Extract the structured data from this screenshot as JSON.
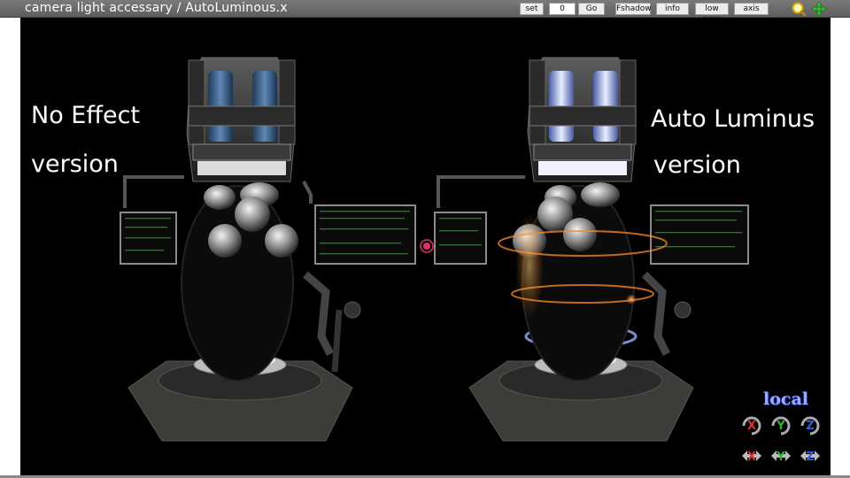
{
  "window": {
    "title": "camera light accessary / AutoLuminous.x"
  },
  "toolbar": {
    "set_label": "set",
    "frame_value": "0",
    "go_label": "Go",
    "fshadow_label": "Fshadow",
    "info_label": "info",
    "lowpow_label": "low pow",
    "axis_label": "axis"
  },
  "captions": {
    "left_line1": "No Effect",
    "left_line2": "version",
    "right_line1": "Auto Luminus",
    "right_line2": "version"
  },
  "axis_widget": {
    "mode_label": "local",
    "x_label": "X",
    "y_label": "Y",
    "z_label": "Z"
  },
  "colors": {
    "viewport_bg": "#000000",
    "titlebar_bg": "#6b6b6b",
    "x_axis": "#e03030",
    "y_axis": "#2fb82f",
    "z_axis": "#3060e0",
    "glow": "#ff9a30"
  }
}
